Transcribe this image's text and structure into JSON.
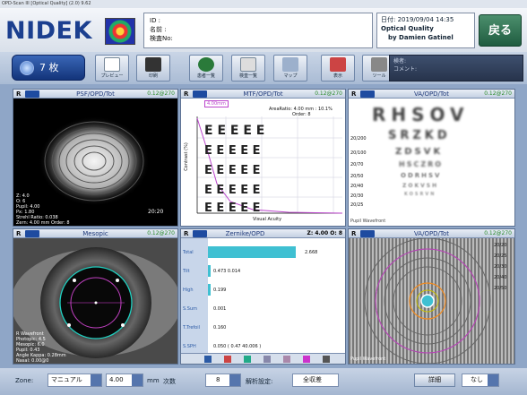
{
  "window_title": "OPD-Scan III [Optical Quality] (2.0) 9.62",
  "header": {
    "logo": "NIDEK",
    "patient": {
      "id": "ID :",
      "name": "名前 :",
      "exam_no": "検査No:"
    },
    "date": "日付: 2019/09/04 14:35",
    "app_mode": "Optical Quality",
    "author": "by Damien Gatinel",
    "back_label": "戻る"
  },
  "toolbar": {
    "main_label": "7 枚",
    "buttons": [
      "プレビュー",
      "印刷",
      "患者一覧",
      "検査一覧",
      "マップ",
      "表示",
      "ツール"
    ],
    "comment_title": "検者:",
    "comment_label": "コメント:"
  },
  "panels": {
    "top_left": {
      "r": "R",
      "title": "PSF/OPD/Tot",
      "info": "0.12@270",
      "overlay": "Z: 4.0\nO: 6\nPupil: 4.00\nPx: 1.80\nStrehl Ratio: 0.038\nZern: 4.00 mm Order: 8",
      "scale": "20:20"
    },
    "top_mid": {
      "r": "R",
      "title": "MTF/OPD/Tot",
      "info": "0.12@270",
      "legend": "4.00mm",
      "annot": [
        "AreaRatio: 4.00 mm : 10.1%",
        "Order: 8"
      ],
      "ylabel": "Contrast (%)",
      "xlabel": "Visual Acuity"
    },
    "top_right": {
      "r": "R",
      "title": "VA/OPD/Tot",
      "info": "0.12@270",
      "rows": [
        "RHSOV",
        "SRZKD",
        "ZDSVK",
        "HSCZRO",
        "ODRHSV",
        "ZOKVSH",
        "KOSRVN"
      ],
      "acuity": [
        "20/200",
        "20/100",
        "20/70",
        "20/50",
        "20/40",
        "20/30",
        "20/25"
      ],
      "caption": "Pupil Wavefront"
    },
    "bottom_left": {
      "r": "R",
      "title": "Mesopic",
      "info": "0.12@270",
      "overlay": "R Wavefront\nPhotopic: 4.5\nMesopic: 6.0\nPupil: 0.43\nAngle Kappa: 0.28mm\nNasal: 0.00@0\nPupil Dist: 0.0mm 0.0"
    },
    "bottom_mid": {
      "r": "R",
      "title": "Zernike/OPD",
      "info": "Z: 4.00 O: 8",
      "items": [
        {
          "label": "Total",
          "value": "2.668"
        },
        {
          "label": "Tilt",
          "value": "0.473 0.014"
        },
        {
          "label": "High",
          "value": "0.199"
        },
        {
          "label": "S.Sum",
          "value": "0.001"
        },
        {
          "label": "T.Trefoil",
          "value": "0.160"
        },
        {
          "label": "S.SPH",
          "value": "0.050 ( 0.47 40.006 )"
        }
      ]
    },
    "bottom_right": {
      "r": "R",
      "title": "VA/OPD/Tot",
      "info": "0.12@270",
      "scale": [
        "20/20",
        "20/25",
        "20/30",
        "20/40",
        "20/50"
      ],
      "caption": "Pupil Wavefront"
    }
  },
  "bottombar": {
    "zone_label": "Zone:",
    "zone_value": "マニュアル",
    "diameter": "4.00",
    "unit": "mm",
    "order_label": "次数",
    "order_value": "8",
    "setting_label": "解析設定:",
    "setting_value": "全収差",
    "detail_btn": "詳細",
    "none_value": "なし"
  }
}
